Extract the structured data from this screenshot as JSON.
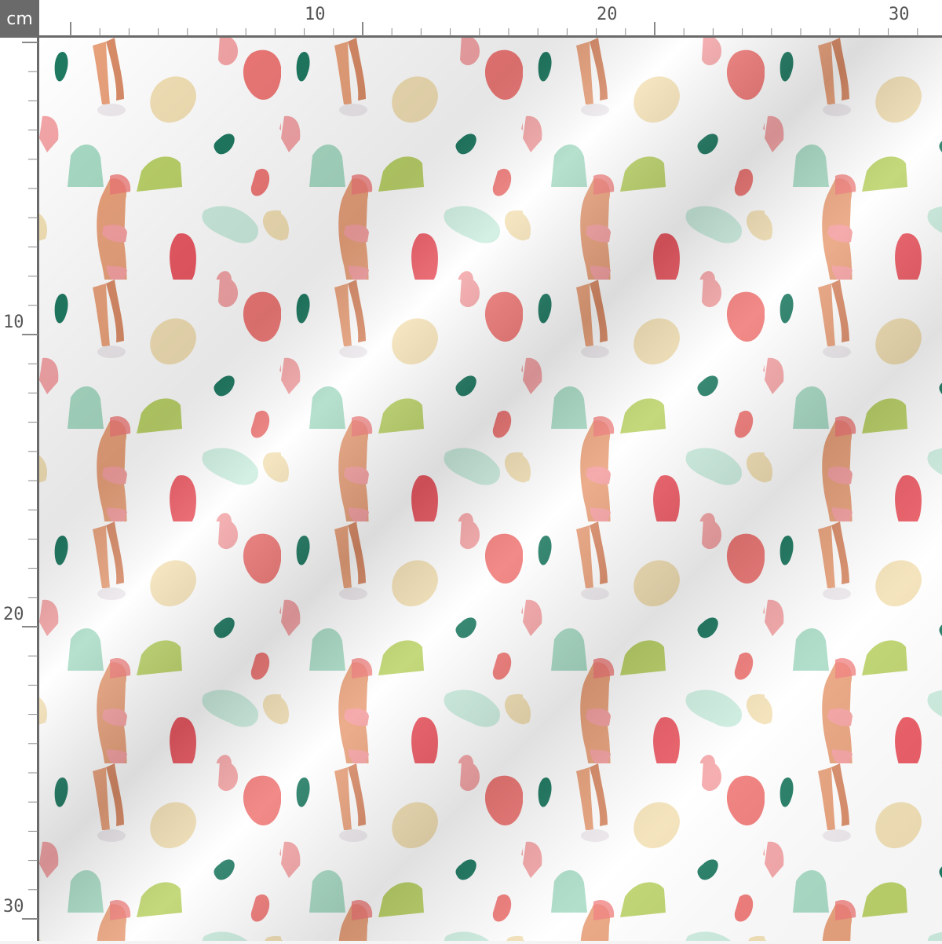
{
  "ruler": {
    "unit": "cm",
    "top_labels": [
      "10",
      "20",
      "30"
    ],
    "left_labels": [
      "10",
      "20",
      "30"
    ]
  },
  "fabric": {
    "pattern_motif": "bikini-woman-figure-with-abstract-blobs",
    "colors": {
      "skin": "#e9a27c",
      "bikini": "#f4a0a0",
      "sneaker": "#eeeaee",
      "dark_green": "#1f7a62",
      "mint": "#a9dcc6",
      "light_mint": "#cdeee0",
      "lime": "#bcd36a",
      "coral": "#f07a78",
      "red": "#ec5a64",
      "pink": "#f5a6a8",
      "sand": "#f3e1b6"
    }
  }
}
